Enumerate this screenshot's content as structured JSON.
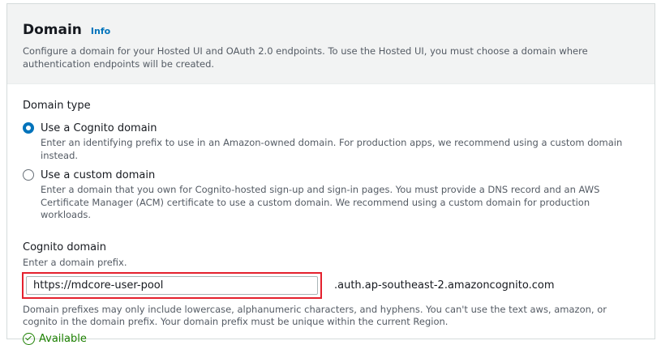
{
  "header": {
    "title": "Domain",
    "info_link": "Info",
    "description": "Configure a domain for your Hosted UI and OAuth 2.0 endpoints. To use the Hosted UI, you must choose a domain where authentication endpoints will be created."
  },
  "domain_type": {
    "label": "Domain type",
    "options": [
      {
        "title": "Use a Cognito domain",
        "description": "Enter an identifying prefix to use in an Amazon-owned domain. For production apps, we recommend using a custom domain instead.",
        "selected": true
      },
      {
        "title": "Use a custom domain",
        "description": "Enter a domain that you own for Cognito-hosted sign-up and sign-in pages. You must provide a DNS record and an AWS Certificate Manager (ACM) certificate to use a custom domain. We recommend using a custom domain for production workloads.",
        "selected": false
      }
    ]
  },
  "cognito_domain": {
    "label": "Cognito domain",
    "description": "Enter a domain prefix.",
    "value": "https://mdcore-user-pool",
    "suffix": ".auth.ap-southeast-2.amazoncognito.com",
    "constraint": "Domain prefixes may only include lowercase, alphanumeric characters, and hyphens. You can't use the text aws, amazon, or cognito in the domain prefix. Your domain prefix must be unique within the current Region.",
    "status": "Available"
  },
  "colors": {
    "accent": "#0073bb",
    "success": "#1d8102",
    "highlight": "#e4212e"
  }
}
